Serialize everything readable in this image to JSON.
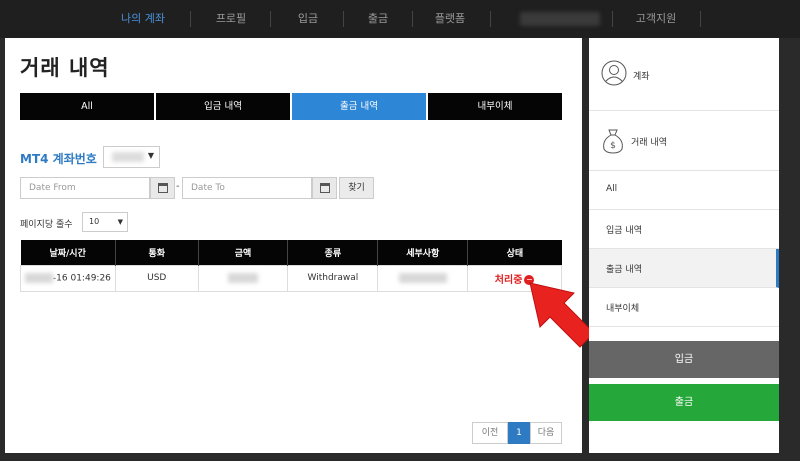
{
  "nav": {
    "items": [
      "나의 계좌",
      "프로필",
      "입금",
      "출금",
      "플랫폼",
      "고객지원"
    ]
  },
  "main": {
    "title": "거래 내역",
    "tabs": [
      "All",
      "입금 내역",
      "출금 내역",
      "내부이체"
    ],
    "account_label": "MT4 계좌번호",
    "date_from_placeholder": "Date From",
    "date_to_placeholder": "Date To",
    "date_separator": "-",
    "find_label": "찾기",
    "per_page_label": "페이지당 줄수",
    "per_page_value": "10",
    "table": {
      "headers": [
        "날짜/시간",
        "통화",
        "금액",
        "종류",
        "세부사항",
        "상태"
      ],
      "rows": [
        {
          "datetime": "-16 01:49:26",
          "currency": "USD",
          "type": "Withdrawal",
          "status": "처리중"
        }
      ]
    },
    "pager": {
      "prev": "이전",
      "page": "1",
      "next": "다음"
    }
  },
  "sidebar": {
    "account_label": "계좌",
    "history_label": "거래 내역",
    "items": [
      "All",
      "입금 내역",
      "출금 내역",
      "내부이체"
    ],
    "deposit_button": "입금",
    "withdraw_button": "출금"
  },
  "colors": {
    "accent": "#2e86d6",
    "status_red": "#e02020",
    "withdraw_green": "#25a73a",
    "deposit_gray": "#666666"
  }
}
